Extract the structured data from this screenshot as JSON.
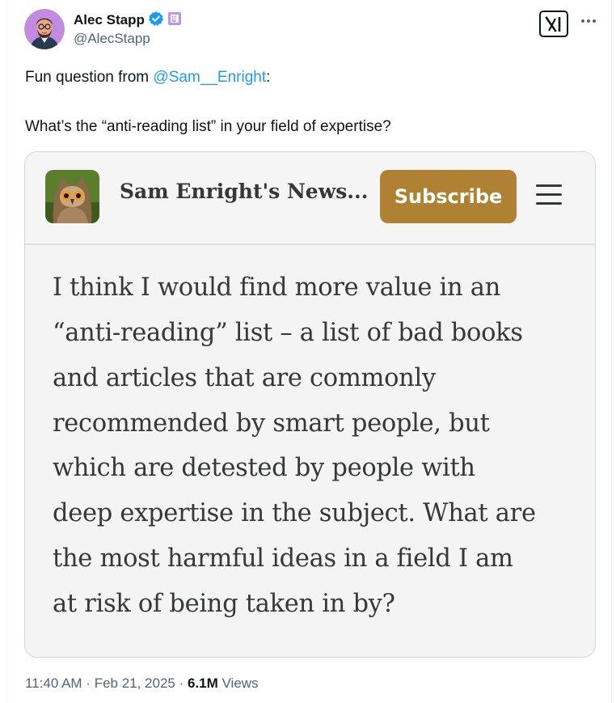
{
  "author": {
    "name": "Alec Stapp",
    "handle": "@AlecStapp",
    "verified_badge_color": "#1d9bf0",
    "affiliate_badge_color": "#b996e6"
  },
  "icons": {
    "avatar": "avatar-illustration",
    "logo": "x-grok-logo-icon",
    "more": "more-horizontal-icon",
    "verified": "verified-badge-icon",
    "affiliate": "affiliate-badge-icon",
    "publication": "owl-logo",
    "menu": "hamburger-menu-icon"
  },
  "tweet": {
    "intro_prefix": "Fun question from ",
    "mention": "@Sam__Enright",
    "intro_suffix": ":",
    "question": "What’s the “anti-reading list” in your field of expertise?"
  },
  "card": {
    "publication_name": "Sam Enright's News...",
    "subscribe_label": "Subscribe",
    "subscribe_color": "#ae8232",
    "quote_lines": [
      "I think I would find more value in an",
      "“anti-reading” list – a list of bad books",
      "and articles that are commonly",
      "recommended by smart people, but",
      "which are detested by people with",
      "deep expertise in the subject. What are",
      "the most harmful ideas in a field I am",
      "at risk of being taken in by?"
    ]
  },
  "meta": {
    "time": "11:40 AM",
    "date": "Feb 21, 2025",
    "separator": " · ",
    "views_count": "6.1M",
    "views_label": " Views"
  }
}
